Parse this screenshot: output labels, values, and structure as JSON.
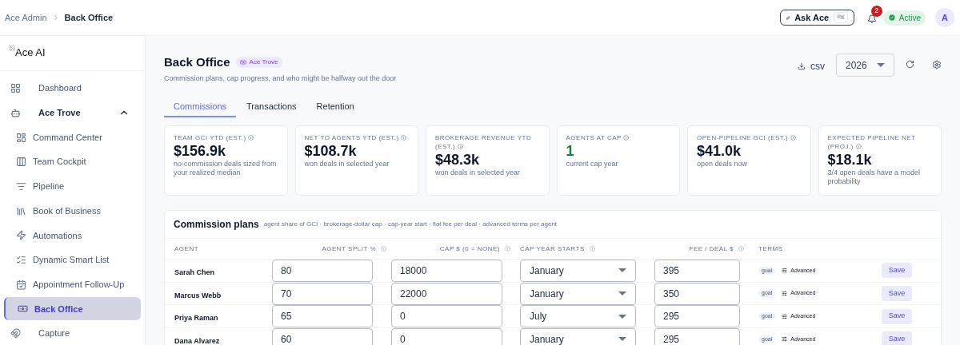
{
  "breadcrumb": [
    "Ace Admin",
    "Back Office"
  ],
  "header": {
    "ask_button": "Ask Ace",
    "shortcut": "⌘K",
    "notification_count": "2",
    "status": "Active",
    "avatar": "A"
  },
  "sidebar": {
    "logo_alt": "Ace AI",
    "items": [
      {
        "label": "Dashboard",
        "selected": false
      },
      {
        "label": "Ace Trove",
        "selected": false,
        "expanded": true,
        "children": [
          {
            "label": "Command Center",
            "selected": false
          },
          {
            "label": "Team Cockpit",
            "selected": false
          },
          {
            "label": "Pipeline",
            "selected": false
          },
          {
            "label": "Book of Business",
            "selected": false
          },
          {
            "label": "Automations",
            "selected": false
          },
          {
            "label": "Dynamic Smart List",
            "selected": false
          },
          {
            "label": "Appointment Follow-Up",
            "selected": false
          },
          {
            "label": "Back Office",
            "selected": true
          }
        ]
      },
      {
        "label": "Capture",
        "selected": false
      }
    ]
  },
  "page": {
    "title": "Back Office",
    "badge": "Ace Trove",
    "subtitle": "Commission plans, cap progress, and who might be halfway out the door",
    "export": "csv",
    "year": "2026"
  },
  "tabs": [
    {
      "label": "Commissions",
      "selected": true
    },
    {
      "label": "Transactions",
      "selected": false
    },
    {
      "label": "Retention",
      "selected": false
    }
  ],
  "stats": [
    {
      "label": "TEAM GCI YTD (EST.)",
      "value": "$156.9k",
      "note": "no-commission deals sized from your realized median",
      "color": "#0f172a"
    },
    {
      "label": "NET TO AGENTS YTD (EST.)",
      "value": "$108.7k",
      "note": "won deals in selected year",
      "color": "#0f172a"
    },
    {
      "label": "BROKERAGE REVENUE YTD (EST.)",
      "value": "$48.3k",
      "note": "won deals in selected year",
      "color": "#0f172a"
    },
    {
      "label": "AGENTS AT CAP",
      "value": "1",
      "note": "current cap year",
      "color": "#15803d"
    },
    {
      "label": "OPEN-PIPELINE GCI (EST.)",
      "value": "$41.0k",
      "note": "open deals now",
      "color": "#0f172a"
    },
    {
      "label": "EXPECTED PIPELINE NET (PROJ.)",
      "value": "$18.1k",
      "note": "3/4 open deals have a model probability",
      "color": "#0f172a"
    }
  ],
  "commission_plans": {
    "title": "Commission plans",
    "description": "agent share of GCI · brokerage-dollar cap · cap-year start · flat fee per deal · advanced terms per agent",
    "columns": [
      {
        "label": "AGENT",
        "info": false
      },
      {
        "label": "AGENT SPLIT %",
        "info": true
      },
      {
        "label": "CAP $ (0 = NONE)",
        "info": true
      },
      {
        "label": "CAP YEAR STARTS",
        "info": true
      },
      {
        "label": "FEE / DEAL $",
        "info": true
      },
      {
        "label": "TERMS",
        "info": false
      }
    ],
    "rows": [
      {
        "agent": "Sarah Chen",
        "split": "80",
        "cap": "18000",
        "cap_year": "January",
        "fee": "395",
        "tag": "goal",
        "terms": "Advanced",
        "action": "Save"
      },
      {
        "agent": "Marcus Webb",
        "split": "70",
        "cap": "22000",
        "cap_year": "January",
        "fee": "350",
        "tag": "goal",
        "terms": "Advanced",
        "action": "Save"
      },
      {
        "agent": "Priya Raman",
        "split": "65",
        "cap": "0",
        "cap_year": "July",
        "fee": "295",
        "tag": "goal",
        "terms": "Advanced",
        "action": "Save"
      },
      {
        "agent": "Dana Alvarez",
        "split": "60",
        "cap": "0",
        "cap_year": "January",
        "fee": "295",
        "tag": "goal",
        "terms": "Advanced",
        "action": "Save"
      }
    ]
  }
}
